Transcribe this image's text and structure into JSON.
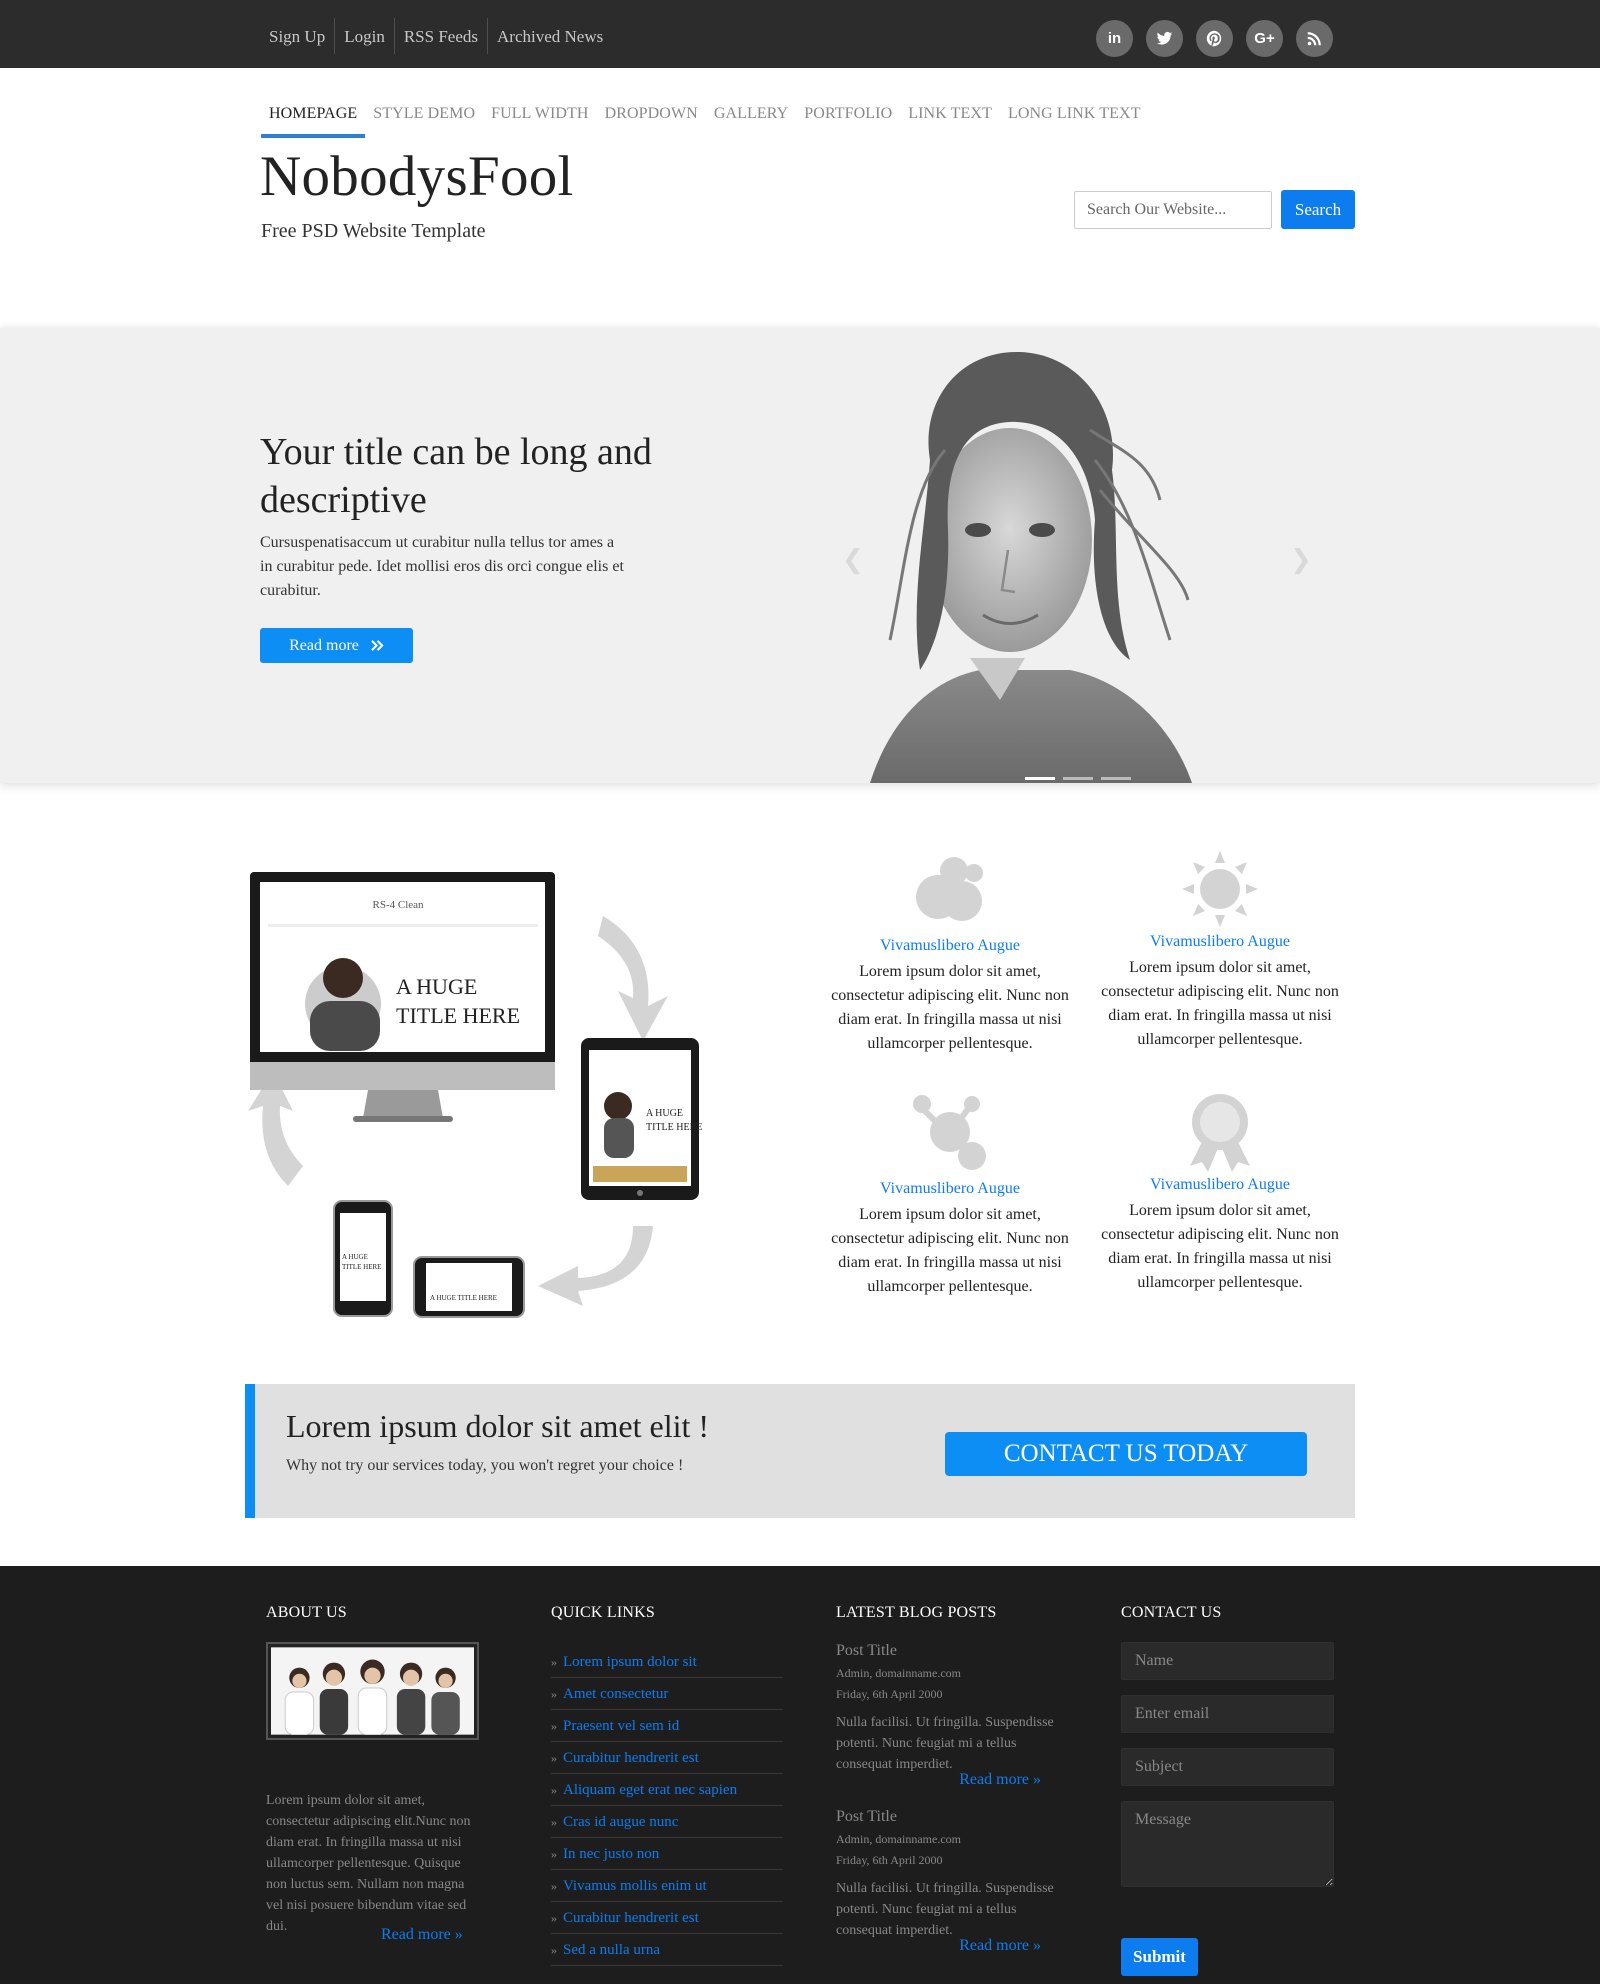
{
  "top_links": [
    "Sign Up",
    "Login",
    "RSS Feeds",
    "Archived News"
  ],
  "social_icons": [
    "linkedin-icon",
    "twitter-icon",
    "pinterest-icon",
    "google-plus-icon",
    "rss-icon"
  ],
  "social_labels": {
    "linkedin": "in",
    "google_plus": "G+"
  },
  "nav": [
    "HOMEPAGE",
    "STYLE DEMO",
    "FULL WIDTH",
    "DROPDOWN",
    "GALLERY",
    "PORTFOLIO",
    "LINK TEXT",
    "LONG LINK TEXT"
  ],
  "site": {
    "title": "NobodysFool",
    "tagline": "Free PSD Website Template"
  },
  "search": {
    "placeholder": "Search Our Website...",
    "button": "Search"
  },
  "hero": {
    "title": "Your title can be long and descriptive",
    "text": "Cursuspenatisaccum ut curabitur nulla tellus tor ames a in curabitur pede. Idet mollisi eros dis orci congue elis et curabitur.",
    "button": "Read more",
    "prev_icon": "chevron-left-icon",
    "next_icon": "chevron-right-icon",
    "slide_count": 3,
    "active_slide": 1
  },
  "devices_screens": {
    "brand": "RS-4 Clean",
    "headline_1": "A HUGE",
    "headline_2": "TITLE HERE",
    "headline_small": "A HUGE TITLE HERE"
  },
  "features": [
    {
      "icon": "bubbles-icon",
      "title": "Vivamuslibero Augue",
      "text": "Lorem ipsum dolor sit amet, consectetur adipiscing elit. Nunc non diam erat. In fringilla massa ut nisi ullamcorper pellentesque."
    },
    {
      "icon": "sun-icon",
      "title": "Vivamuslibero Augue",
      "text": "Lorem ipsum dolor sit amet, consectetur adipiscing elit. Nunc non diam erat. In fringilla massa ut nisi ullamcorper pellentesque."
    },
    {
      "icon": "molecule-icon",
      "title": "Vivamuslibero Augue",
      "text": "Lorem ipsum dolor sit amet, consectetur adipiscing elit. Nunc non diam erat. In fringilla massa ut nisi ullamcorper pellentesque."
    },
    {
      "icon": "award-ribbon-icon",
      "title": "Vivamuslibero Augue",
      "text": "Lorem ipsum dolor sit amet, consectetur adipiscing elit. Nunc non diam erat. In fringilla massa ut nisi ullamcorper pellentesque."
    }
  ],
  "cta": {
    "title": "Lorem ipsum dolor sit amet elit !",
    "subtitle": "Why not try our services today, you won't regret your choice !",
    "button": "CONTACT US TODAY"
  },
  "footer": {
    "about": {
      "heading": "ABOUT US",
      "text": "Lorem ipsum dolor sit amet, consectetur adipiscing elit.Nunc non diam erat. In fringilla massa ut nisi ullamcorper pellentesque. Quisque non luctus sem. Nullam non magna vel nisi posuere bibendum vitae sed dui.",
      "read_more": "Read more »"
    },
    "quick_links": {
      "heading": "QUICK LINKS",
      "bullet": "»",
      "items": [
        "Lorem ipsum dolor sit",
        "Amet consectetur",
        "Praesent vel sem id",
        "Curabitur hendrerit est",
        "Aliquam eget erat nec sapien",
        "Cras id augue nunc",
        "In nec justo non",
        "Vivamus mollis enim ut",
        "Curabitur hendrerit est",
        "Sed a nulla urna"
      ]
    },
    "blog": {
      "heading": "LATEST BLOG POSTS",
      "posts": [
        {
          "title": "Post Title",
          "author": "Admin, domainname.com",
          "date": "Friday, 6th April 2000",
          "text": "Nulla facilisi. Ut fringilla. Suspendisse potenti. Nunc feugiat mi a tellus consequat imperdiet.",
          "read_more": "Read more »"
        },
        {
          "title": "Post Title",
          "author": "Admin, domainname.com",
          "date": "Friday, 6th April 2000",
          "text": "Nulla facilisi. Ut fringilla. Suspendisse potenti. Nunc feugiat mi a tellus consequat imperdiet.",
          "read_more": "Read more »"
        }
      ]
    },
    "contact": {
      "heading": "CONTACT US",
      "name_placeholder": "Name",
      "email_placeholder": "Enter email",
      "subject_placeholder": "Subject",
      "message_placeholder": "Message",
      "submit": "Submit"
    }
  },
  "colors": {
    "accent": "#0d8ef5",
    "link": "#0d7cef",
    "topbar": "#2c2c2c",
    "footer": "#1d1d1d"
  }
}
